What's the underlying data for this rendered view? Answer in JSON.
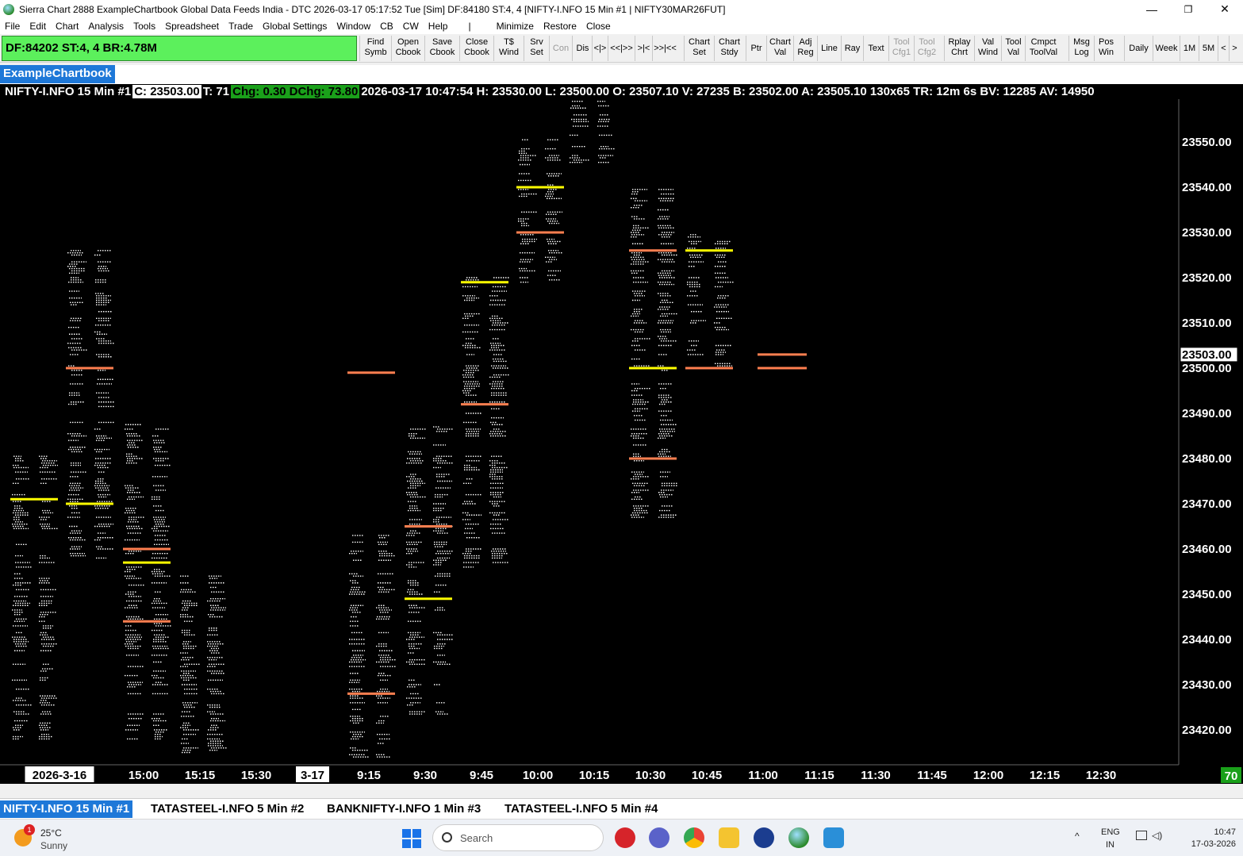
{
  "window": {
    "title": "Sierra Chart 2888 ExampleChartbook Global Data Feeds India - DTC 2026-03-17  05:17:52 Tue [Sim] DF:84180  ST:4, 4 [NIFTY-I.NFO  15 Min  #1 | NIFTY30MAR26FUT]",
    "minimize": "—",
    "maximize": "❐",
    "close": "✕"
  },
  "menu": [
    "File",
    "Edit",
    "Chart",
    "Analysis",
    "Tools",
    "Spreadsheet",
    "Trade",
    "Global Settings",
    "Window",
    "CB",
    "CW",
    "Help",
    "|",
    "Minimize",
    "Restore",
    "Close"
  ],
  "status_box": "DF:84202  ST:4, 4  BR:4.78M",
  "toolbar": [
    {
      "label": "Find\nSymb",
      "dim": false
    },
    {
      "label": "Open\nCbook",
      "dim": false
    },
    {
      "label": "Save\nCbook",
      "dim": false
    },
    {
      "label": "Close\nCbook",
      "dim": false
    },
    {
      "label": "T$\nWind",
      "dim": false
    },
    {
      "label": "Srv\nSet",
      "dim": false
    },
    {
      "label": "Con",
      "dim": true
    },
    {
      "label": "Dis",
      "dim": false
    },
    {
      "label": "<|>",
      "dim": false
    },
    {
      "label": "<<|>>",
      "dim": false
    },
    {
      "label": ">|<",
      "dim": false
    },
    {
      "label": ">>|<<",
      "dim": false
    },
    {
      "label": "Chart\nSet",
      "dim": false
    },
    {
      "label": "Chart\nStdy",
      "dim": false
    },
    {
      "label": "Ptr",
      "dim": false
    },
    {
      "label": "Chart\nVal",
      "dim": false
    },
    {
      "label": "Adj\nReg",
      "dim": false
    },
    {
      "label": "Line",
      "dim": false
    },
    {
      "label": "Ray",
      "dim": false
    },
    {
      "label": "Text",
      "dim": false
    },
    {
      "label": "Tool\nCfg1",
      "dim": true
    },
    {
      "label": "Tool\nCfg2",
      "dim": true
    },
    {
      "label": "Rplay\nChrt",
      "dim": false
    },
    {
      "label": "Val\nWind",
      "dim": false
    },
    {
      "label": "Tool\nVal",
      "dim": false
    },
    {
      "label": "Cmpct\nToolVal",
      "dim": false
    },
    {
      "label": "Msg\nLog",
      "dim": false
    },
    {
      "label": "Pos\nWin",
      "dim": false
    },
    {
      "label": "Daily",
      "dim": false
    },
    {
      "label": "Week",
      "dim": false
    },
    {
      "label": "1M",
      "dim": false
    },
    {
      "label": "5M",
      "dim": false
    },
    {
      "label": "<",
      "dim": false
    },
    {
      "label": ">",
      "dim": false
    }
  ],
  "chartbook_tab": "ExampleChartbook",
  "info": {
    "symbol": "NIFTY-I.NFO  15 Min  #1",
    "close": "C: 23503.00",
    "trades": "T: 71",
    "chg": "Chg: 0.30",
    "dchg": "DChg: 73.80",
    "rest": "2026-03-17 10:47:54 H: 23530.00 L: 23500.00 O: 23507.10 V: 27235 B: 23502.00 A: 23505.10 130x65 TR: 12m 6s BV: 12285 AV: 14950"
  },
  "price_axis": {
    "labels": [
      "23550.00",
      "23540.00",
      "23530.00",
      "23520.00",
      "23510.00",
      "23503.00",
      "23500.00",
      "23490.00",
      "23480.00",
      "23470.00",
      "23460.00",
      "23450.00",
      "23440.00",
      "23430.00",
      "23420.00"
    ],
    "current": "23503.00"
  },
  "time_axis": {
    "labels": [
      "2026-3-16",
      "15:00",
      "15:15",
      "15:30",
      "3-17",
      "9:15",
      "9:30",
      "9:45",
      "10:00",
      "10:15",
      "10:30",
      "10:45",
      "11:00",
      "11:15",
      "11:30",
      "11:45",
      "12:00",
      "12:15",
      "12:30"
    ],
    "boxed": [
      "2026-3-16",
      "3-17"
    ]
  },
  "countdown": "70",
  "chart_data": {
    "type": "footprint",
    "y_axis_range": [
      23414,
      23560
    ],
    "y_tick_step": 10,
    "current_price": 23503.0,
    "bars": [
      {
        "time": "2026-3-16 14:30",
        "low": 23418,
        "high": 23481,
        "poc": 23471,
        "vah": null,
        "val": null
      },
      {
        "time": "2026-3-16 14:45",
        "low": 23458,
        "high": 23526,
        "poc": 23470,
        "vah": 23500,
        "val": null
      },
      {
        "time": "2026-3-16 15:00",
        "low": 23418,
        "high": 23490,
        "poc": 23457,
        "vah": 23460,
        "val": 23444
      },
      {
        "time": "2026-3-16 15:15",
        "low": 23414,
        "high": 23454,
        "poc": null,
        "vah": null,
        "val": null
      },
      {
        "time": "2026-3-17 09:15",
        "low": 23414,
        "high": 23463,
        "poc": null,
        "vah": 23499,
        "val": 23428
      },
      {
        "time": "2026-3-17 09:30",
        "low": 23422,
        "high": 23487,
        "poc": 23449,
        "vah": 23465,
        "val": null
      },
      {
        "time": "2026-3-17 09:45",
        "low": 23456,
        "high": 23520,
        "poc": 23519,
        "vah": 23492,
        "val": null
      },
      {
        "time": "2026-3-17 10:00",
        "low": 23518,
        "high": 23551,
        "poc": 23540,
        "vah": 23530,
        "val": null
      },
      {
        "time": "2026-3-17 10:15",
        "low": 23545,
        "high": 23560,
        "poc": null,
        "vah": null,
        "val": null
      },
      {
        "time": "2026-3-17 10:30",
        "low": 23466,
        "high": 23540,
        "poc": 23500,
        "vah": 23526,
        "val": 23480
      },
      {
        "time": "2026-3-17 10:45",
        "low": 23500,
        "high": 23530,
        "poc": 23526,
        "vah": 23500,
        "val": null
      },
      {
        "time": "2026-3-17 11:00",
        "low": 23500,
        "high": 23503,
        "poc": null,
        "vah": 23503,
        "val": 23500
      }
    ]
  },
  "sheet_tabs": [
    {
      "label": "NIFTY-I.NFO  15 Min  #1",
      "active": true
    },
    {
      "label": "TATASTEEL-I.NFO  5 Min  #2",
      "active": false
    },
    {
      "label": "BANKNIFTY-I.NFO  1 Min  #3",
      "active": false
    },
    {
      "label": "TATASTEEL-I.NFO  5 Min  #4",
      "active": false
    }
  ],
  "taskbar": {
    "weather_temp": "25°C",
    "weather_desc": "Sunny",
    "weather_badge": "1",
    "search_placeholder": "Search",
    "lang1": "ENG",
    "lang2": "IN",
    "time": "10:47",
    "date": "17-03-2026"
  },
  "colors": {
    "poc": "#ffff00",
    "va": "#ff7f50",
    "text": "#ffffff",
    "status_green": "#5cf05c",
    "tab_blue": "#1e78d8"
  }
}
